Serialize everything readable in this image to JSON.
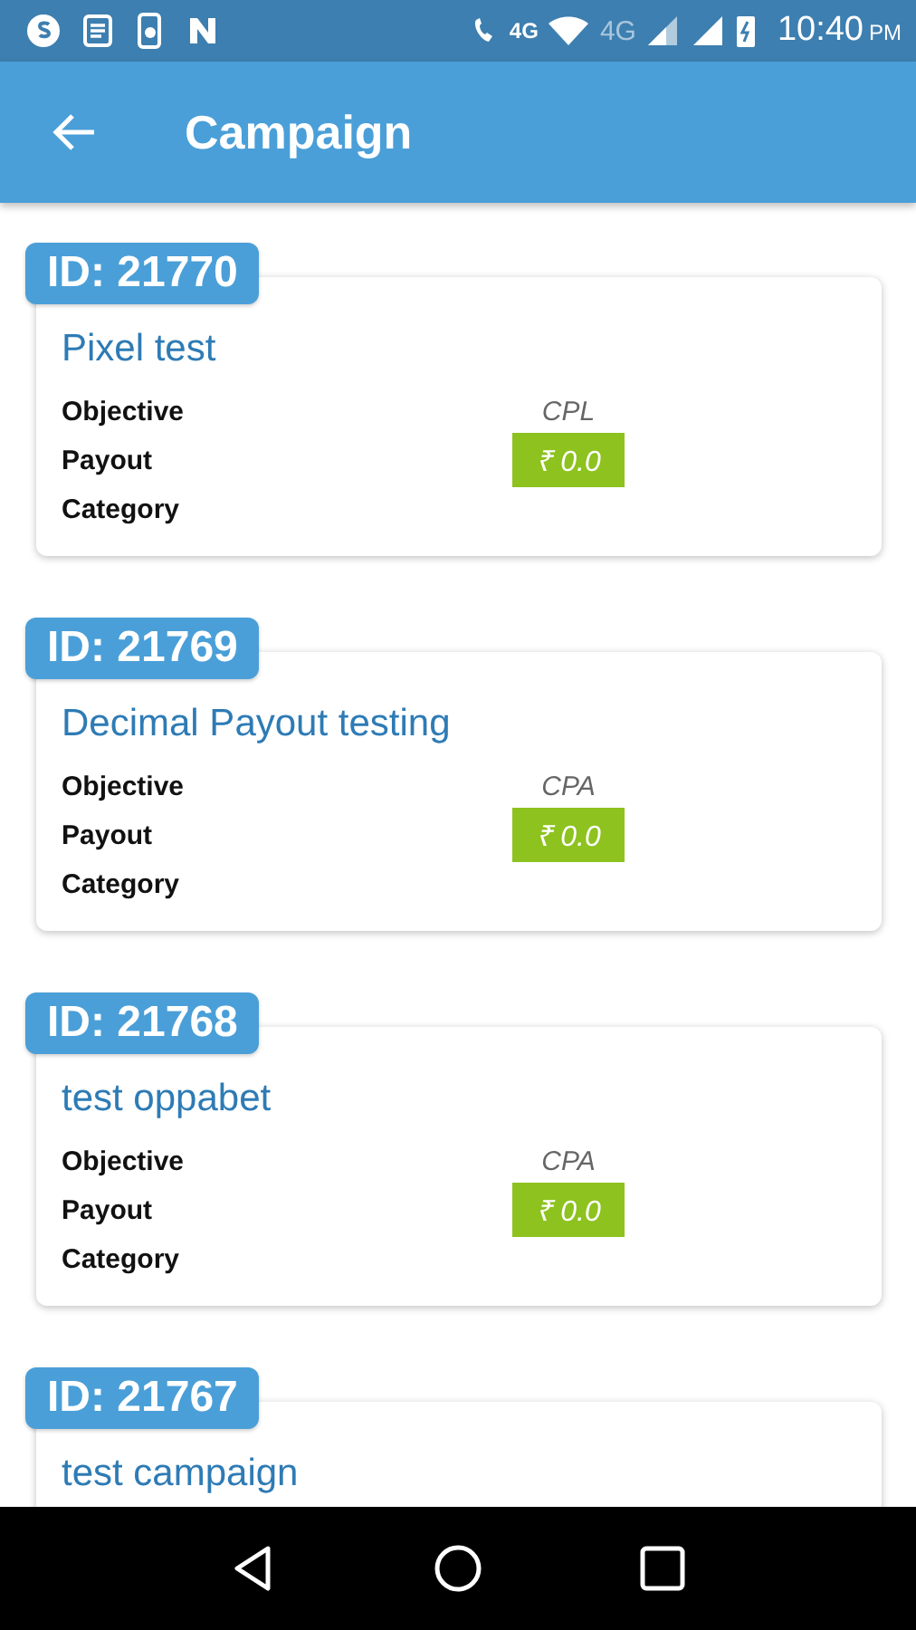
{
  "status_bar": {
    "network_labels": [
      "4G",
      "4G"
    ],
    "time": "10:40",
    "meridiem": "PM"
  },
  "app_bar": {
    "title": "Campaign"
  },
  "campaigns": [
    {
      "id": "ID: 21770",
      "title": "Pixel test",
      "fields": [
        {
          "label": "Objective",
          "value": "CPL",
          "kind": "text"
        },
        {
          "label": "Payout",
          "value": "₹ 0.0",
          "kind": "payout"
        },
        {
          "label": "Category"
        }
      ]
    },
    {
      "id": "ID: 21769",
      "title": "Decimal Payout testing",
      "fields": [
        {
          "label": "Objective",
          "value": "CPA",
          "kind": "text"
        },
        {
          "label": "Payout",
          "value": "₹ 0.0",
          "kind": "payout"
        },
        {
          "label": "Category"
        }
      ]
    },
    {
      "id": "ID: 21768",
      "title": "test oppabet",
      "fields": [
        {
          "label": "Objective",
          "value": "CPA",
          "kind": "text"
        },
        {
          "label": "Payout",
          "value": "₹ 0.0",
          "kind": "payout"
        },
        {
          "label": "Category"
        }
      ]
    },
    {
      "id": "ID: 21767",
      "title": "test campaign"
    }
  ]
}
